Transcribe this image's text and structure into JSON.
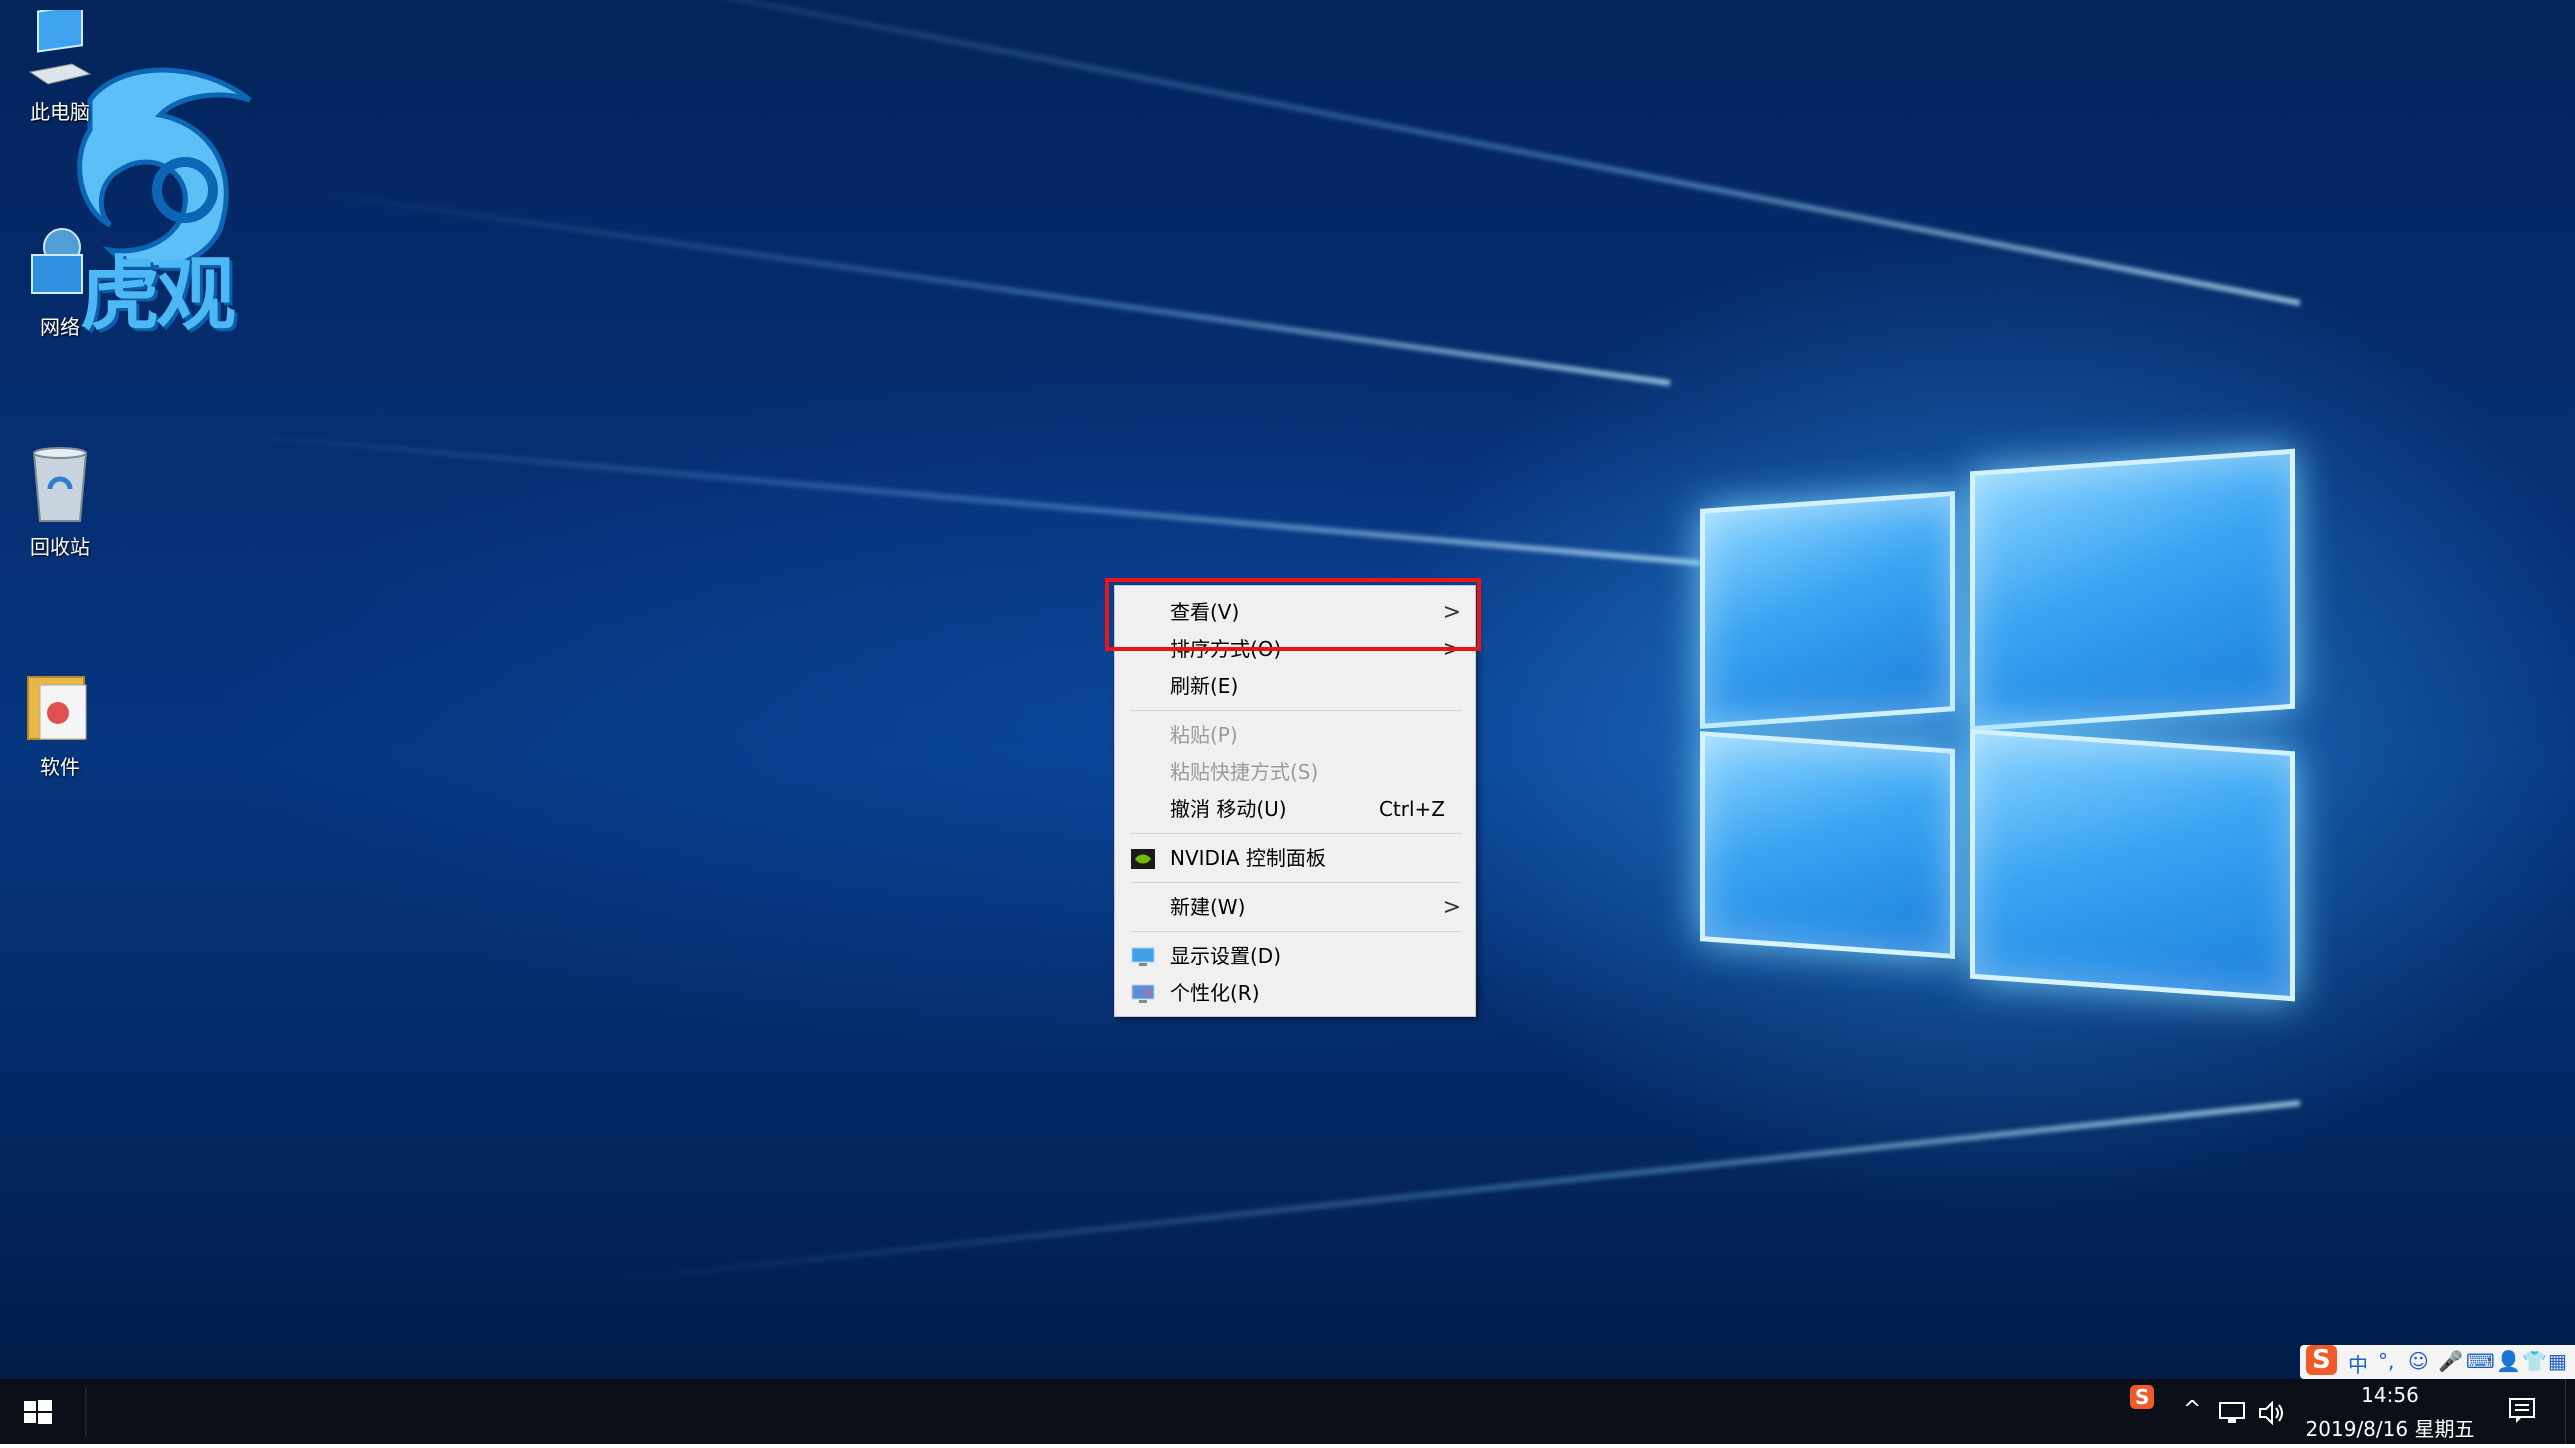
{
  "desktop": {
    "icons": [
      {
        "label": "此电脑"
      },
      {
        "label": "网络"
      },
      {
        "label": "回收站"
      },
      {
        "label": "软件"
      }
    ],
    "watermark_text": "虎观"
  },
  "context_menu": {
    "items": [
      {
        "label": "查看(V)",
        "submenu": true,
        "highlighted": true
      },
      {
        "label": "排序方式(O)",
        "submenu": true
      },
      {
        "label": "刷新(E)"
      },
      {
        "label": "粘贴(P)",
        "disabled": true
      },
      {
        "label": "粘贴快捷方式(S)",
        "disabled": true
      },
      {
        "label": "撤消 移动(U)",
        "shortcut": "Ctrl+Z"
      },
      {
        "label": "NVIDIA 控制面板",
        "icon": "nvidia-icon"
      },
      {
        "label": "新建(W)",
        "submenu": true
      },
      {
        "label": "显示设置(D)",
        "icon": "display-settings-icon"
      },
      {
        "label": "个性化(R)",
        "icon": "personalize-icon"
      }
    ],
    "submenu_arrow": ">"
  },
  "taskbar": {
    "clock_time": "14:56",
    "clock_date": "2019/8/16 星期五",
    "ime_mode": "中",
    "ime_punct": "°,",
    "sogou_logo": "S",
    "show_hidden_icon": "^"
  },
  "colors": {
    "highlight_border": "#e8161b",
    "menu_bg": "#f0f0f0",
    "taskbar_bg": "#0a0f18"
  }
}
